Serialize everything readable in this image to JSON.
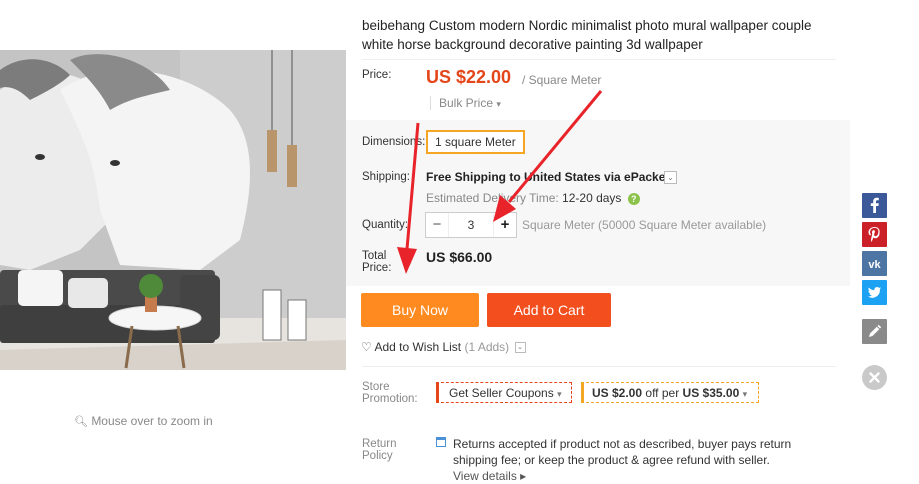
{
  "product": {
    "title": "beibehang Custom modern Nordic minimalist photo mural wallpaper couple white horse background decorative painting 3d wallpaper",
    "zoom_hint": "Mouse over to zoom in"
  },
  "price": {
    "label": "Price:",
    "value": "US $22.00",
    "unit": "/ Square Meter",
    "bulk_label": "Bulk Price",
    "bulk_caret": "▾"
  },
  "dimensions": {
    "label": "Dimensions:",
    "option": "1 square Meter"
  },
  "shipping": {
    "label": "Shipping:",
    "value": "Free Shipping to United States via ePacket",
    "dropdown": "⌄",
    "delivery_label": "Estimated Delivery Time:",
    "delivery_value": "12-20 days",
    "help": "?"
  },
  "quantity": {
    "label": "Quantity:",
    "minus": "−",
    "value": "3",
    "plus": "+",
    "availability": "Square Meter (50000 Square Meter available)"
  },
  "total": {
    "label": "Total Price:",
    "value": "US $66.00"
  },
  "actions": {
    "buy_now": "Buy Now",
    "add_to_cart": "Add to Cart",
    "wishlist": "Add to Wish List",
    "wishlist_count": "(1 Adds)",
    "wishlist_caret": "⌄"
  },
  "promotion": {
    "label": "Store Promotion:",
    "coupon": "Get Seller Coupons",
    "coupon_caret": "▾",
    "discount_amount": "US $2.00",
    "discount_mid": "off per",
    "discount_threshold": "US $35.00",
    "discount_caret": "▾"
  },
  "return_policy": {
    "label": "Return Policy",
    "text": "Returns accepted if product not as described, buyer pays return shipping fee; or keep the product & agree refund with seller.",
    "view_details": "View details ▸"
  },
  "share_bar": {
    "icons": [
      "facebook-icon",
      "pinterest-icon",
      "vk-icon",
      "twitter-icon",
      "edit-icon",
      "close-icon"
    ],
    "colors": {
      "facebook": "#3b5998",
      "pinterest": "#cb2027",
      "vk": "#4c75a3",
      "twitter": "#1da1f2",
      "edit": "#8a8a8a",
      "close": "#c9c9c9"
    }
  },
  "colors": {
    "price": "#e4461a",
    "buy_now": "#ff8a1f",
    "add_to_cart": "#f24e1e",
    "annotation_arrow": "#e8232a"
  }
}
